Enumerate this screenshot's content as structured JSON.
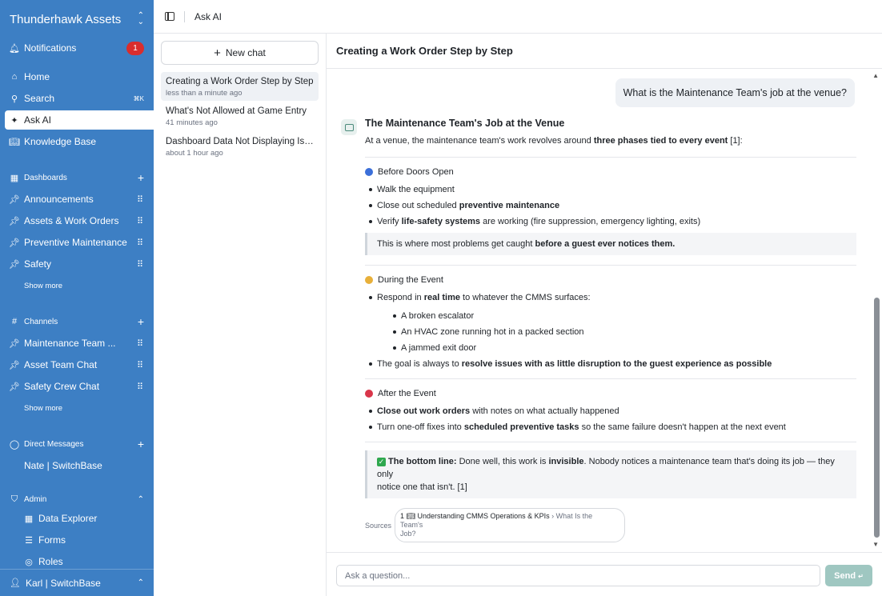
{
  "sidebar": {
    "brand": "Thunderhawk Assets",
    "notifications": {
      "label": "Notifications",
      "count": "1"
    },
    "nav": [
      {
        "label": "Home"
      },
      {
        "label": "Search",
        "shortcut": "⌘K"
      },
      {
        "label": "Ask AI"
      },
      {
        "label": "Knowledge Base"
      }
    ],
    "dashboards": {
      "title": "Dashboards",
      "items": [
        {
          "label": "Announcements"
        },
        {
          "label": "Assets & Work Orders"
        },
        {
          "label": "Preventive Maintenance"
        },
        {
          "label": "Safety"
        }
      ],
      "show_more": "Show more"
    },
    "channels": {
      "title": "Channels",
      "items": [
        {
          "label": "Maintenance Team ..."
        },
        {
          "label": "Asset Team Chat"
        },
        {
          "label": "Safety Crew Chat"
        }
      ],
      "show_more": "Show more"
    },
    "direct_messages": {
      "title": "Direct Messages",
      "items": [
        {
          "label": "Nate | SwitchBase"
        }
      ]
    },
    "admin": {
      "title": "Admin",
      "items": [
        {
          "label": "Data Explorer"
        },
        {
          "label": "Forms"
        },
        {
          "label": "Roles"
        }
      ]
    },
    "user": "Karl | SwitchBase"
  },
  "topbar": {
    "title": "Ask AI"
  },
  "chatlist": {
    "new_chat": "New chat",
    "items": [
      {
        "title": "Creating a Work Order Step by Step",
        "time": "less than a minute ago"
      },
      {
        "title": "What's Not Allowed at Game Entry",
        "time": "41 minutes ago"
      },
      {
        "title": "Dashboard Data Not Displaying Iss...",
        "time": "about 1 hour ago"
      }
    ]
  },
  "conversation": {
    "title": "Creating a Work Order Step by Step",
    "user_message": "What is the Maintenance Team's job at the venue?",
    "answer": {
      "heading": "The Maintenance Team's Job at the Venue",
      "intro_pre": "At a venue, the maintenance team's work revolves around ",
      "intro_bold": "three phases tied to every event",
      "intro_post": " [1]:",
      "phase1": {
        "title": "Before Doors Open",
        "color": "#3b6fd9",
        "b1": "Walk the equipment",
        "b2_pre": "Close out scheduled ",
        "b2_bold": "preventive maintenance",
        "b3_pre": "Verify ",
        "b3_bold": "life-safety systems",
        "b3_post": " are working (fire suppression, emergency lighting, exits)",
        "quote_pre": "This is where most problems get caught ",
        "quote_bold": "before a guest ever notices them."
      },
      "phase2": {
        "title": "During the Event",
        "color": "#e8b03a",
        "b1_pre": "Respond in ",
        "b1_bold": "real time",
        "b1_post": " to whatever the CMMS surfaces:",
        "sub1": "A broken escalator",
        "sub2": "An HVAC zone running hot in a packed section",
        "sub3": "A jammed exit door",
        "b2_pre": "The goal is always to ",
        "b2_bold": "resolve issues with as little disruption to the guest experience as possible"
      },
      "phase3": {
        "title": "After the Event",
        "color": "#d9364a",
        "b1_bold": "Close out work orders",
        "b1_post": " with notes on what actually happened",
        "b2_pre": "Turn one-off fixes into ",
        "b2_bold": "scheduled preventive tasks",
        "b2_post": " so the same failure doesn't happen at the next event"
      },
      "bottom_line": {
        "label": "The bottom line:",
        "pre": " Done well, this work is ",
        "bold": "invisible",
        "post1": ". Nobody notices a maintenance team that's doing its job — they only",
        "post2": "notice one that isn't. [1]"
      },
      "sources": {
        "label": "Sources",
        "index": "1",
        "doc": "Understanding CMMS Operations & KPIs",
        "section": "› What Is the Team's",
        "section2": "Job?"
      }
    }
  },
  "composer": {
    "placeholder": "Ask a question...",
    "send_label": "Send"
  }
}
